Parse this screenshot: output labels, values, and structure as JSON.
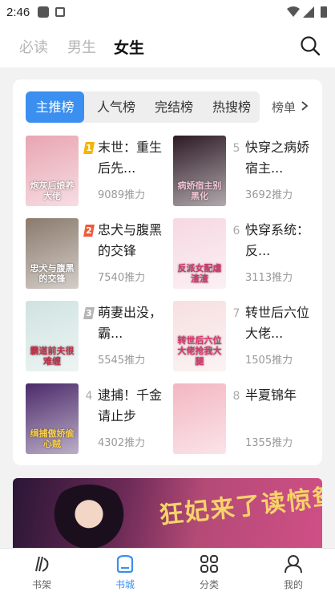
{
  "status_bar": {
    "time": "2:46"
  },
  "top_tabs": [
    "必读",
    "男生",
    "女生"
  ],
  "active_top_tab": 2,
  "category_tabs": [
    "主推榜",
    "人气榜",
    "完结榜",
    "热搜榜"
  ],
  "more_label": "榜单",
  "books": [
    {
      "rank": "1",
      "title": "末世：重生后先...",
      "meta": "9089推力",
      "cover_title": "炮灰后娘养大佬",
      "cover_bg": "#e8a5b2",
      "cover_fg": "#fff5f5"
    },
    {
      "rank": "2",
      "title": "忠犬与腹黑的交锋",
      "meta": "7540推力",
      "cover_title": "忠犬与腹黑的交锋",
      "cover_bg": "#8a7a6c",
      "cover_fg": "#ffffff"
    },
    {
      "rank": "3",
      "title": "萌妻出没，霸...",
      "meta": "5545推力",
      "cover_title": "霸道前夫很难缠",
      "cover_bg": "#cfe3e0",
      "cover_fg": "#c0304a"
    },
    {
      "rank": "4",
      "title": "逮捕！千金请止步",
      "meta": "4302推力",
      "cover_title": "缉捕傲娇偷心贼",
      "cover_bg": "#4b2a6a",
      "cover_fg": "#ffd34d"
    },
    {
      "rank": "5",
      "title": "快穿之病娇宿主...",
      "meta": "3692推力",
      "cover_title": "病娇宿主别黑化",
      "cover_bg": "#2d1a24",
      "cover_fg": "#f4c7d6"
    },
    {
      "rank": "6",
      "title": "快穿系统：反...",
      "meta": "3113推力",
      "cover_title": "反派女配虐渣渣",
      "cover_bg": "#f6d8e2",
      "cover_fg": "#d6336c"
    },
    {
      "rank": "7",
      "title": "转世后六位大佬...",
      "meta": "1505推力",
      "cover_title": "转世后六位大佬抢我大腿",
      "cover_bg": "#f7dfe0",
      "cover_fg": "#e0326a"
    },
    {
      "rank": "8",
      "title": "半夏锦年",
      "meta": "1355推力",
      "cover_title": "",
      "cover_bg": "#f3b6c2",
      "cover_fg": "#ffffff"
    }
  ],
  "rank_badge_colors": {
    "1": "#f4b400",
    "2": "#f05a3a",
    "3": "#b5b5b5"
  },
  "banner": {
    "text": "狂妃来了读惊鸳"
  },
  "bottom_nav": [
    {
      "label": "书架",
      "icon": "bookshelf-icon"
    },
    {
      "label": "书城",
      "icon": "bookstore-icon"
    },
    {
      "label": "分类",
      "icon": "category-icon"
    },
    {
      "label": "我的",
      "icon": "profile-icon"
    }
  ],
  "active_bottom": 1,
  "colors": {
    "accent": "#3b8ff0"
  }
}
